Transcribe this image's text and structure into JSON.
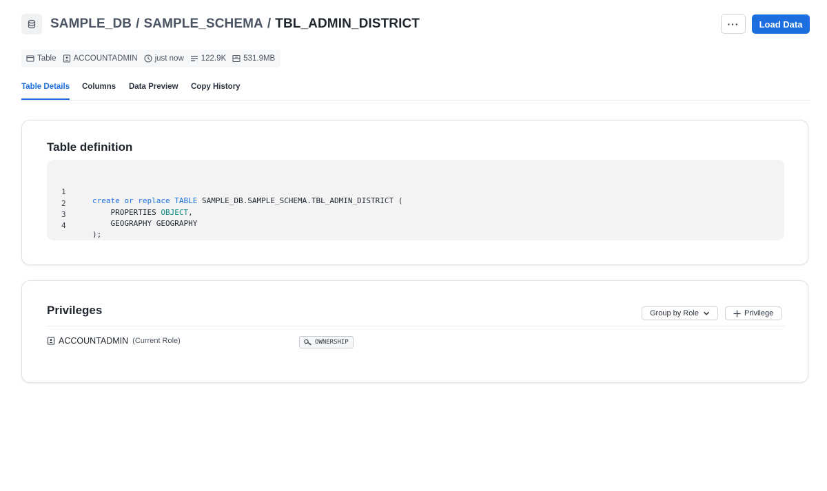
{
  "breadcrumb": {
    "database": "SAMPLE_DB",
    "schema": "SAMPLE_SCHEMA",
    "table": "TBL_ADMIN_DISTRICT",
    "separator": "/"
  },
  "actions": {
    "more_label": "···",
    "load_data_label": "Load Data"
  },
  "meta": {
    "type": "Table",
    "owner": "ACCOUNTADMIN",
    "updated": "just now",
    "rows": "122.9K",
    "size": "531.9MB"
  },
  "tabs": [
    {
      "label": "Table Details",
      "active": true
    },
    {
      "label": "Columns",
      "active": false
    },
    {
      "label": "Data Preview",
      "active": false
    },
    {
      "label": "Copy History",
      "active": false
    }
  ],
  "definition": {
    "title": "Table definition",
    "lines": [
      {
        "num": "1",
        "k1": "create",
        "k2": "or",
        "k3": "replace",
        "k4": "TABLE",
        "rest": " SAMPLE_DB.SAMPLE_SCHEMA.TBL_ADMIN_DISTRICT ("
      },
      {
        "num": "2",
        "col": "PROPERTIES",
        "type": "OBJECT",
        "tail": ","
      },
      {
        "num": "3",
        "text": "    GEOGRAPHY GEOGRAPHY"
      },
      {
        "num": "4",
        "text": ");"
      }
    ]
  },
  "privileges": {
    "title": "Privileges",
    "group_by_label": "Group by Role",
    "add_privilege_label": "Privilege",
    "role": "ACCOUNTADMIN",
    "role_note": "(Current Role)",
    "grant": "OWNERSHIP"
  },
  "colors": {
    "accent": "#1d6fdf",
    "keyword": "#1d6fdf",
    "type": "#10857e"
  },
  "icons": [
    "database-icon",
    "table-icon",
    "role-icon",
    "clock-icon",
    "rows-icon",
    "storage-icon",
    "chevron-down-icon",
    "plus-icon",
    "key-icon"
  ]
}
